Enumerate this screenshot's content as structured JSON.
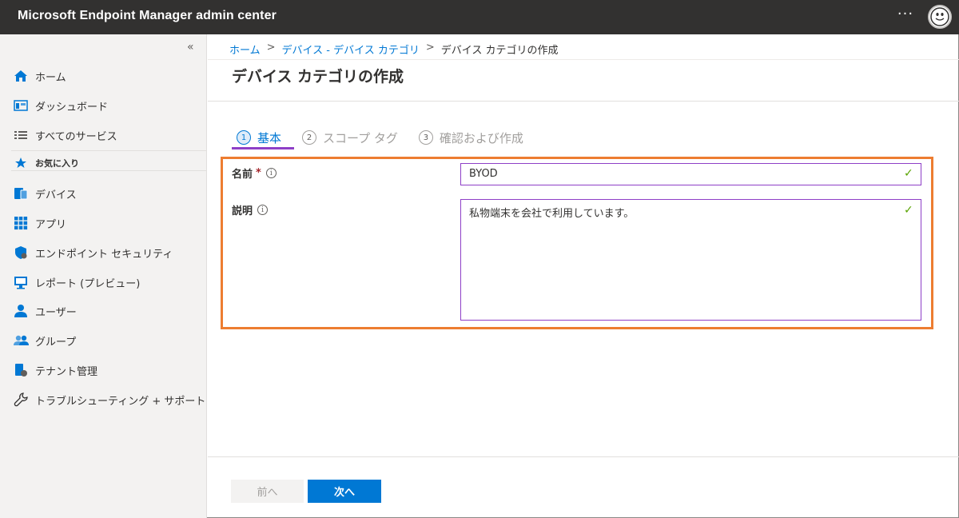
{
  "app": {
    "title": "Microsoft Endpoint Manager admin center",
    "more_label": "···"
  },
  "sidebar": {
    "collapse_label": "«",
    "items": [
      {
        "label": "ホーム",
        "icon": "home-icon"
      },
      {
        "label": "ダッシュボード",
        "icon": "dashboard-icon"
      },
      {
        "label": "すべてのサービス",
        "icon": "list-icon"
      },
      {
        "label": "お気に入り",
        "icon": "star-icon"
      },
      {
        "label": "デバイス",
        "icon": "devices-icon"
      },
      {
        "label": "アプリ",
        "icon": "apps-icon"
      },
      {
        "label": "エンドポイント セキュリティ",
        "icon": "shield-icon"
      },
      {
        "label": "レポート (プレビュー)",
        "icon": "reports-icon"
      },
      {
        "label": "ユーザー",
        "icon": "user-icon"
      },
      {
        "label": "グループ",
        "icon": "groups-icon"
      },
      {
        "label": "テナント管理",
        "icon": "tenant-icon"
      },
      {
        "label": "トラブルシューティング + サポート",
        "icon": "wrench-icon"
      }
    ]
  },
  "breadcrumb": {
    "items": [
      "ホーム",
      "デバイス - デバイス カテゴリ",
      "デバイス カテゴリの作成"
    ],
    "separator": ">"
  },
  "page": {
    "title": "デバイス カテゴリの作成"
  },
  "steps": [
    {
      "number": "1",
      "label": "基本"
    },
    {
      "number": "2",
      "label": "スコープ タグ"
    },
    {
      "number": "3",
      "label": "確認および作成"
    }
  ],
  "form": {
    "name_label": "名前",
    "required_mark": "*",
    "name_value": "BYOD",
    "description_label": "説明",
    "description_value": "私物端末を会社で利用しています。",
    "info_glyph": "i",
    "check_glyph": "✓"
  },
  "footer": {
    "prev_label": "前へ",
    "next_label": "次へ"
  },
  "colors": {
    "topbar": "#323130",
    "accent": "#0078d4",
    "highlight": "#ed7d31",
    "input_border": "#8e3fc7",
    "valid": "#57a300"
  }
}
